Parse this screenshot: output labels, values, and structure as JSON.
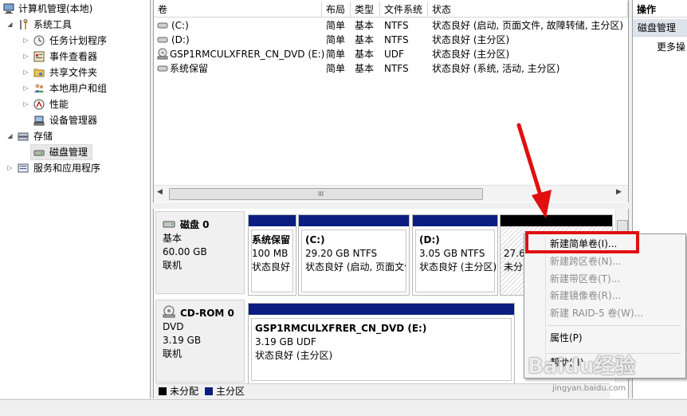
{
  "tree": {
    "root": "计算机管理(本地)",
    "items": [
      {
        "label": "系统工具",
        "level": 1,
        "expanded": true
      },
      {
        "label": "任务计划程序",
        "level": 2
      },
      {
        "label": "事件查看器",
        "level": 2
      },
      {
        "label": "共享文件夹",
        "level": 2
      },
      {
        "label": "本地用户和组",
        "level": 2
      },
      {
        "label": "性能",
        "level": 2
      },
      {
        "label": "设备管理器",
        "level": 2
      },
      {
        "label": "存储",
        "level": 1,
        "expanded": true
      },
      {
        "label": "磁盘管理",
        "level": 2,
        "selected": true
      },
      {
        "label": "服务和应用程序",
        "level": 1
      }
    ]
  },
  "volumes": {
    "headers": [
      "卷",
      "布局",
      "类型",
      "文件系统",
      "状态"
    ],
    "rows": [
      [
        "(C:)",
        "简单",
        "基本",
        "NTFS",
        "状态良好 (启动, 页面文件, 故障转储, 主分区)"
      ],
      [
        "(D:)",
        "简单",
        "基本",
        "NTFS",
        "状态良好 (主分区)"
      ],
      [
        "GSP1RMCULXFRER_CN_DVD (E:)",
        "简单",
        "基本",
        "UDF",
        "状态良好 (主分区)"
      ],
      [
        "系统保留",
        "简单",
        "基本",
        "NTFS",
        "状态良好 (系统, 活动, 主分区)"
      ]
    ],
    "scroll_mark": "III"
  },
  "ops": {
    "title": "操作",
    "section": "磁盘管理",
    "more": "更多操"
  },
  "disks": [
    {
      "name": "磁盘 0",
      "kind": "基本",
      "size": "60.00 GB",
      "status": "联机",
      "partitions": [
        {
          "name": "系统保留",
          "size": "100 MB",
          "status": "状态良好"
        },
        {
          "name": "(C:)",
          "size": "29.20 GB NTFS",
          "status": "状态良好 (启动, 页面文件"
        },
        {
          "name": "(D:)",
          "size": "3.05 GB NTFS",
          "status": "状态良好 (主分区)"
        },
        {
          "name": "",
          "size": "27.6",
          "status": "未分"
        }
      ]
    },
    {
      "name": "CD-ROM 0",
      "kind": "DVD",
      "size": "3.19 GB",
      "status": "联机",
      "partitions": [
        {
          "name": "GSP1RMCULXFRER_CN_DVD  (E:)",
          "size": "3.19 GB UDF",
          "status": "状态良好 (主分区)"
        }
      ]
    }
  ],
  "legend": {
    "unallocated": "未分配",
    "primary": "主分区"
  },
  "menu": {
    "items": [
      {
        "label": "新建简单卷(I)...",
        "enabled": true
      },
      {
        "label": "新建跨区卷(N)...",
        "enabled": false
      },
      {
        "label": "新建带区卷(T)...",
        "enabled": false
      },
      {
        "label": "新建镜像卷(R)...",
        "enabled": false
      },
      {
        "label": "新建 RAID-5 卷(W)...",
        "enabled": false
      },
      {
        "label": "属性(P)",
        "enabled": true
      },
      {
        "label": "帮助(H)",
        "enabled": true
      }
    ]
  },
  "watermark": {
    "brand": "Baidu经验",
    "url": "jingyan.baidu.com"
  },
  "colors": {
    "primary": "#0b1e80",
    "unallocated": "#000000",
    "highlight": "#e01010"
  }
}
